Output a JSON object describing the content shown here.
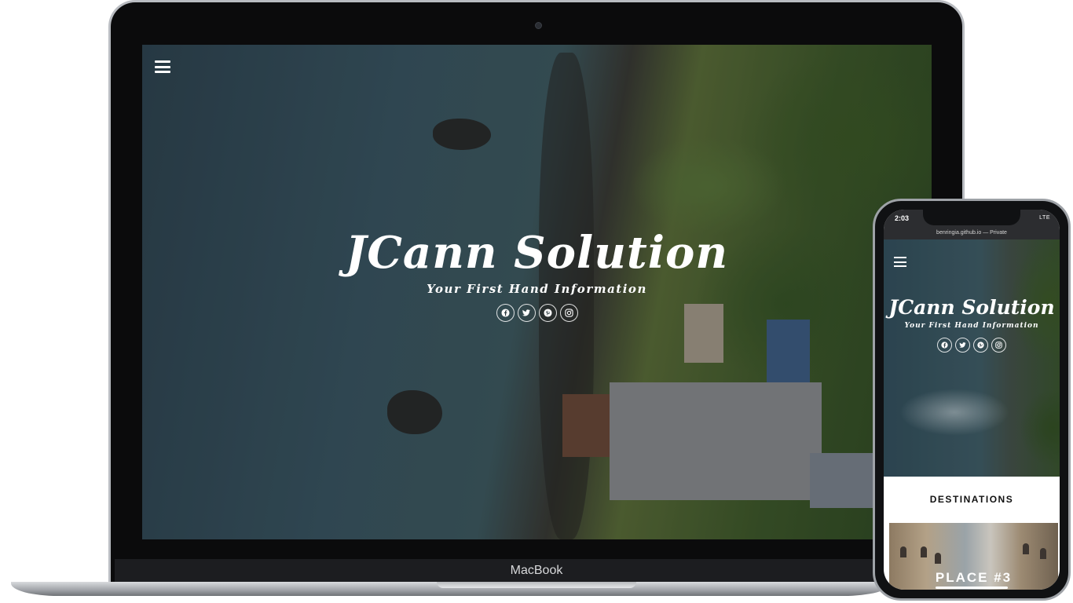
{
  "laptop": {
    "brand": "MacBook",
    "site": {
      "title": "JCann Solution",
      "subtitle": "Your First Hand Information",
      "socials": [
        "facebook-icon",
        "twitter-icon",
        "pinterest-icon",
        "instagram-icon"
      ]
    }
  },
  "phone": {
    "status": {
      "time": "2:03",
      "network": "LTE"
    },
    "url": "benringia.github.io — Private",
    "site": {
      "title": "JCann Solution",
      "subtitle": "Your First Hand Information",
      "socials": [
        "facebook-icon",
        "twitter-icon",
        "pinterest-icon",
        "instagram-icon"
      ]
    },
    "section_title": "DESTINATIONS",
    "place_card": {
      "label": "PLACE #3"
    }
  },
  "colors": {
    "text_light": "#ffffff",
    "section_text": "#111111",
    "device_frame": "#0b0b0c"
  }
}
